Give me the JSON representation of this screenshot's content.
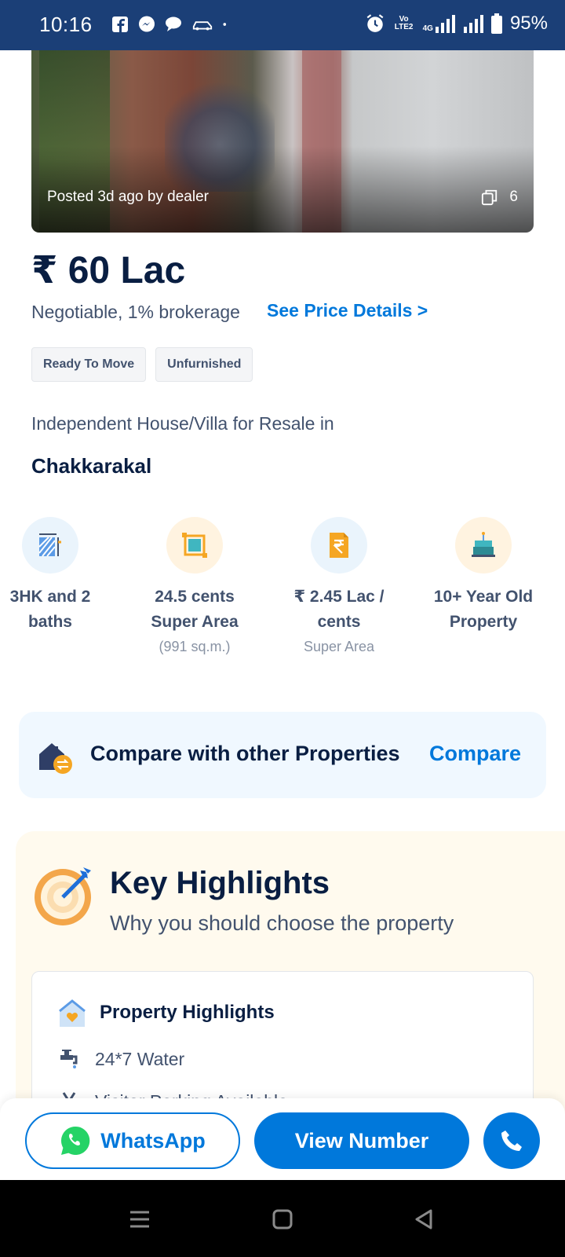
{
  "status_bar": {
    "time": "10:16",
    "battery": "95%",
    "network_label": "4G",
    "volte_label": "Vo LTE2"
  },
  "listing": {
    "posted": "Posted 3d ago by dealer",
    "photo_count": "6",
    "price": "₹ 60 Lac",
    "price_note": "Negotiable, 1% brokerage",
    "price_link": "See Price Details >",
    "tags": [
      "Ready To Move",
      "Unfurnished"
    ],
    "property_type": "Independent House/Villa for Resale in",
    "location": "Chakkarakal"
  },
  "features": [
    {
      "line1": "3HK and 2",
      "line2": "baths",
      "sub": "",
      "icon": "layout-icon"
    },
    {
      "line1": "24.5 cents",
      "line2": "Super Area",
      "sub": "(991 sq.m.)",
      "icon": "area-icon"
    },
    {
      "line1": "₹ 2.45 Lac /",
      "line2": "cents",
      "sub": "Super Area",
      "icon": "rupee-icon"
    },
    {
      "line1": "10+ Year Old",
      "line2": "Property",
      "sub": "",
      "icon": "cake-icon"
    }
  ],
  "compare": {
    "text": "Compare with other Properties",
    "link": "Compare"
  },
  "key_highlights": {
    "title": "Key Highlights",
    "subtitle": "Why you should choose the property",
    "card_title": "Property Highlights",
    "items": [
      "24*7 Water",
      "Visitor Parking Available"
    ]
  },
  "actions": {
    "whatsapp": "WhatsApp",
    "view_number": "View Number"
  },
  "colors": {
    "brand_blue": "#0078DB",
    "status_bar": "#1B3F77",
    "heading": "#091E42"
  }
}
